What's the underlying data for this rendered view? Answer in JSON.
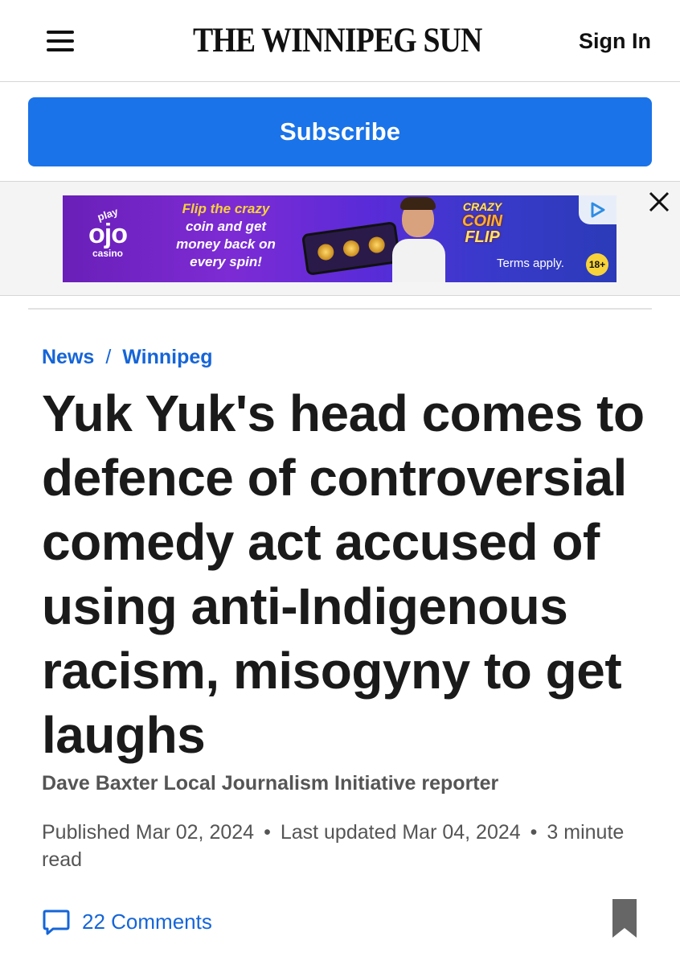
{
  "header": {
    "logo_text": "THE WINNIPEG SUN",
    "signin_label": "Sign In"
  },
  "subscribe": {
    "label": "Subscribe"
  },
  "ad": {
    "brand_top": "play",
    "brand_main": "ojo",
    "brand_bottom": "casino",
    "tagline_line1": "Flip the crazy",
    "tagline_line2": "coin and get",
    "tagline_line3": "money back on",
    "tagline_line4": "every spin!",
    "game_line1": "CRAZY",
    "game_line2": "COIN",
    "game_line3": "FLIP",
    "terms": "Terms apply.",
    "age_badge": "18+",
    "choice_icon": "ad-choices-icon",
    "close_icon": "close-icon"
  },
  "breadcrumb": {
    "section": "News",
    "separator": "/",
    "subsection": "Winnipeg"
  },
  "article": {
    "headline": "Yuk Yuk's head comes to defence of controversial comedy act accused of using anti-Indigenous racism, misogyny to get laughs",
    "byline": "Dave Baxter Local Journalism Initiative reporter",
    "published": "Published Mar 02, 2024",
    "updated": "Last updated Mar 04, 2024",
    "read_time": "3 minute read",
    "meta_separator": "•"
  },
  "actions": {
    "comments_label": "22 Comments",
    "comments_icon": "comment-bubble-icon",
    "bookmark_icon": "bookmark-icon"
  },
  "colors": {
    "accent_blue": "#1a73e8",
    "link_blue": "#1565d8",
    "text_dark": "#1a1a1a",
    "text_muted": "#555555",
    "bookmark_gray": "#666666"
  }
}
